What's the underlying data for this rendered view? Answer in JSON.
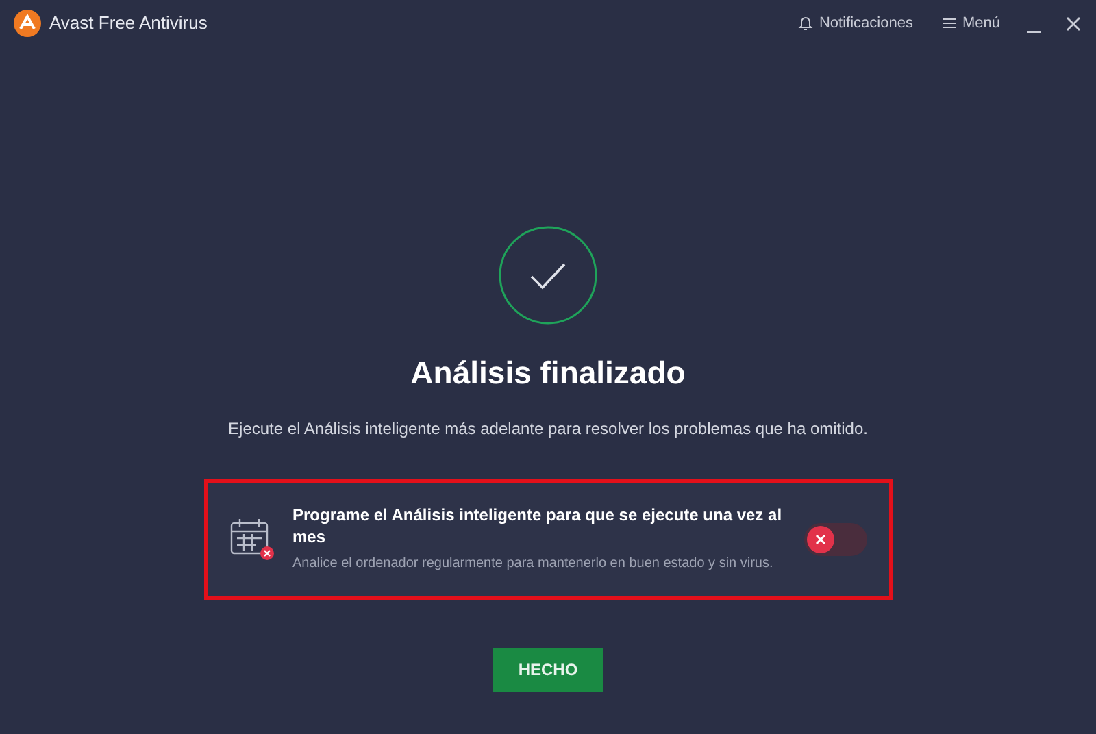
{
  "window": {
    "title": "Avast Free Antivirus",
    "notifications": "Notificaciones",
    "menu": "Menú"
  },
  "status": {
    "title": "Análisis finalizado",
    "message": "Ejecute el Análisis inteligente más adelante para resolver los problemas que ha omitido."
  },
  "schedule": {
    "title": "Programe el Análisis inteligente para que se ejecute una vez al mes",
    "description": "Analice el ordenador regularmente para mantenerlo en buen estado y sin virus.",
    "on": false,
    "highlighted": true
  },
  "buttons": [
    {
      "label": "HECHO"
    }
  ]
}
